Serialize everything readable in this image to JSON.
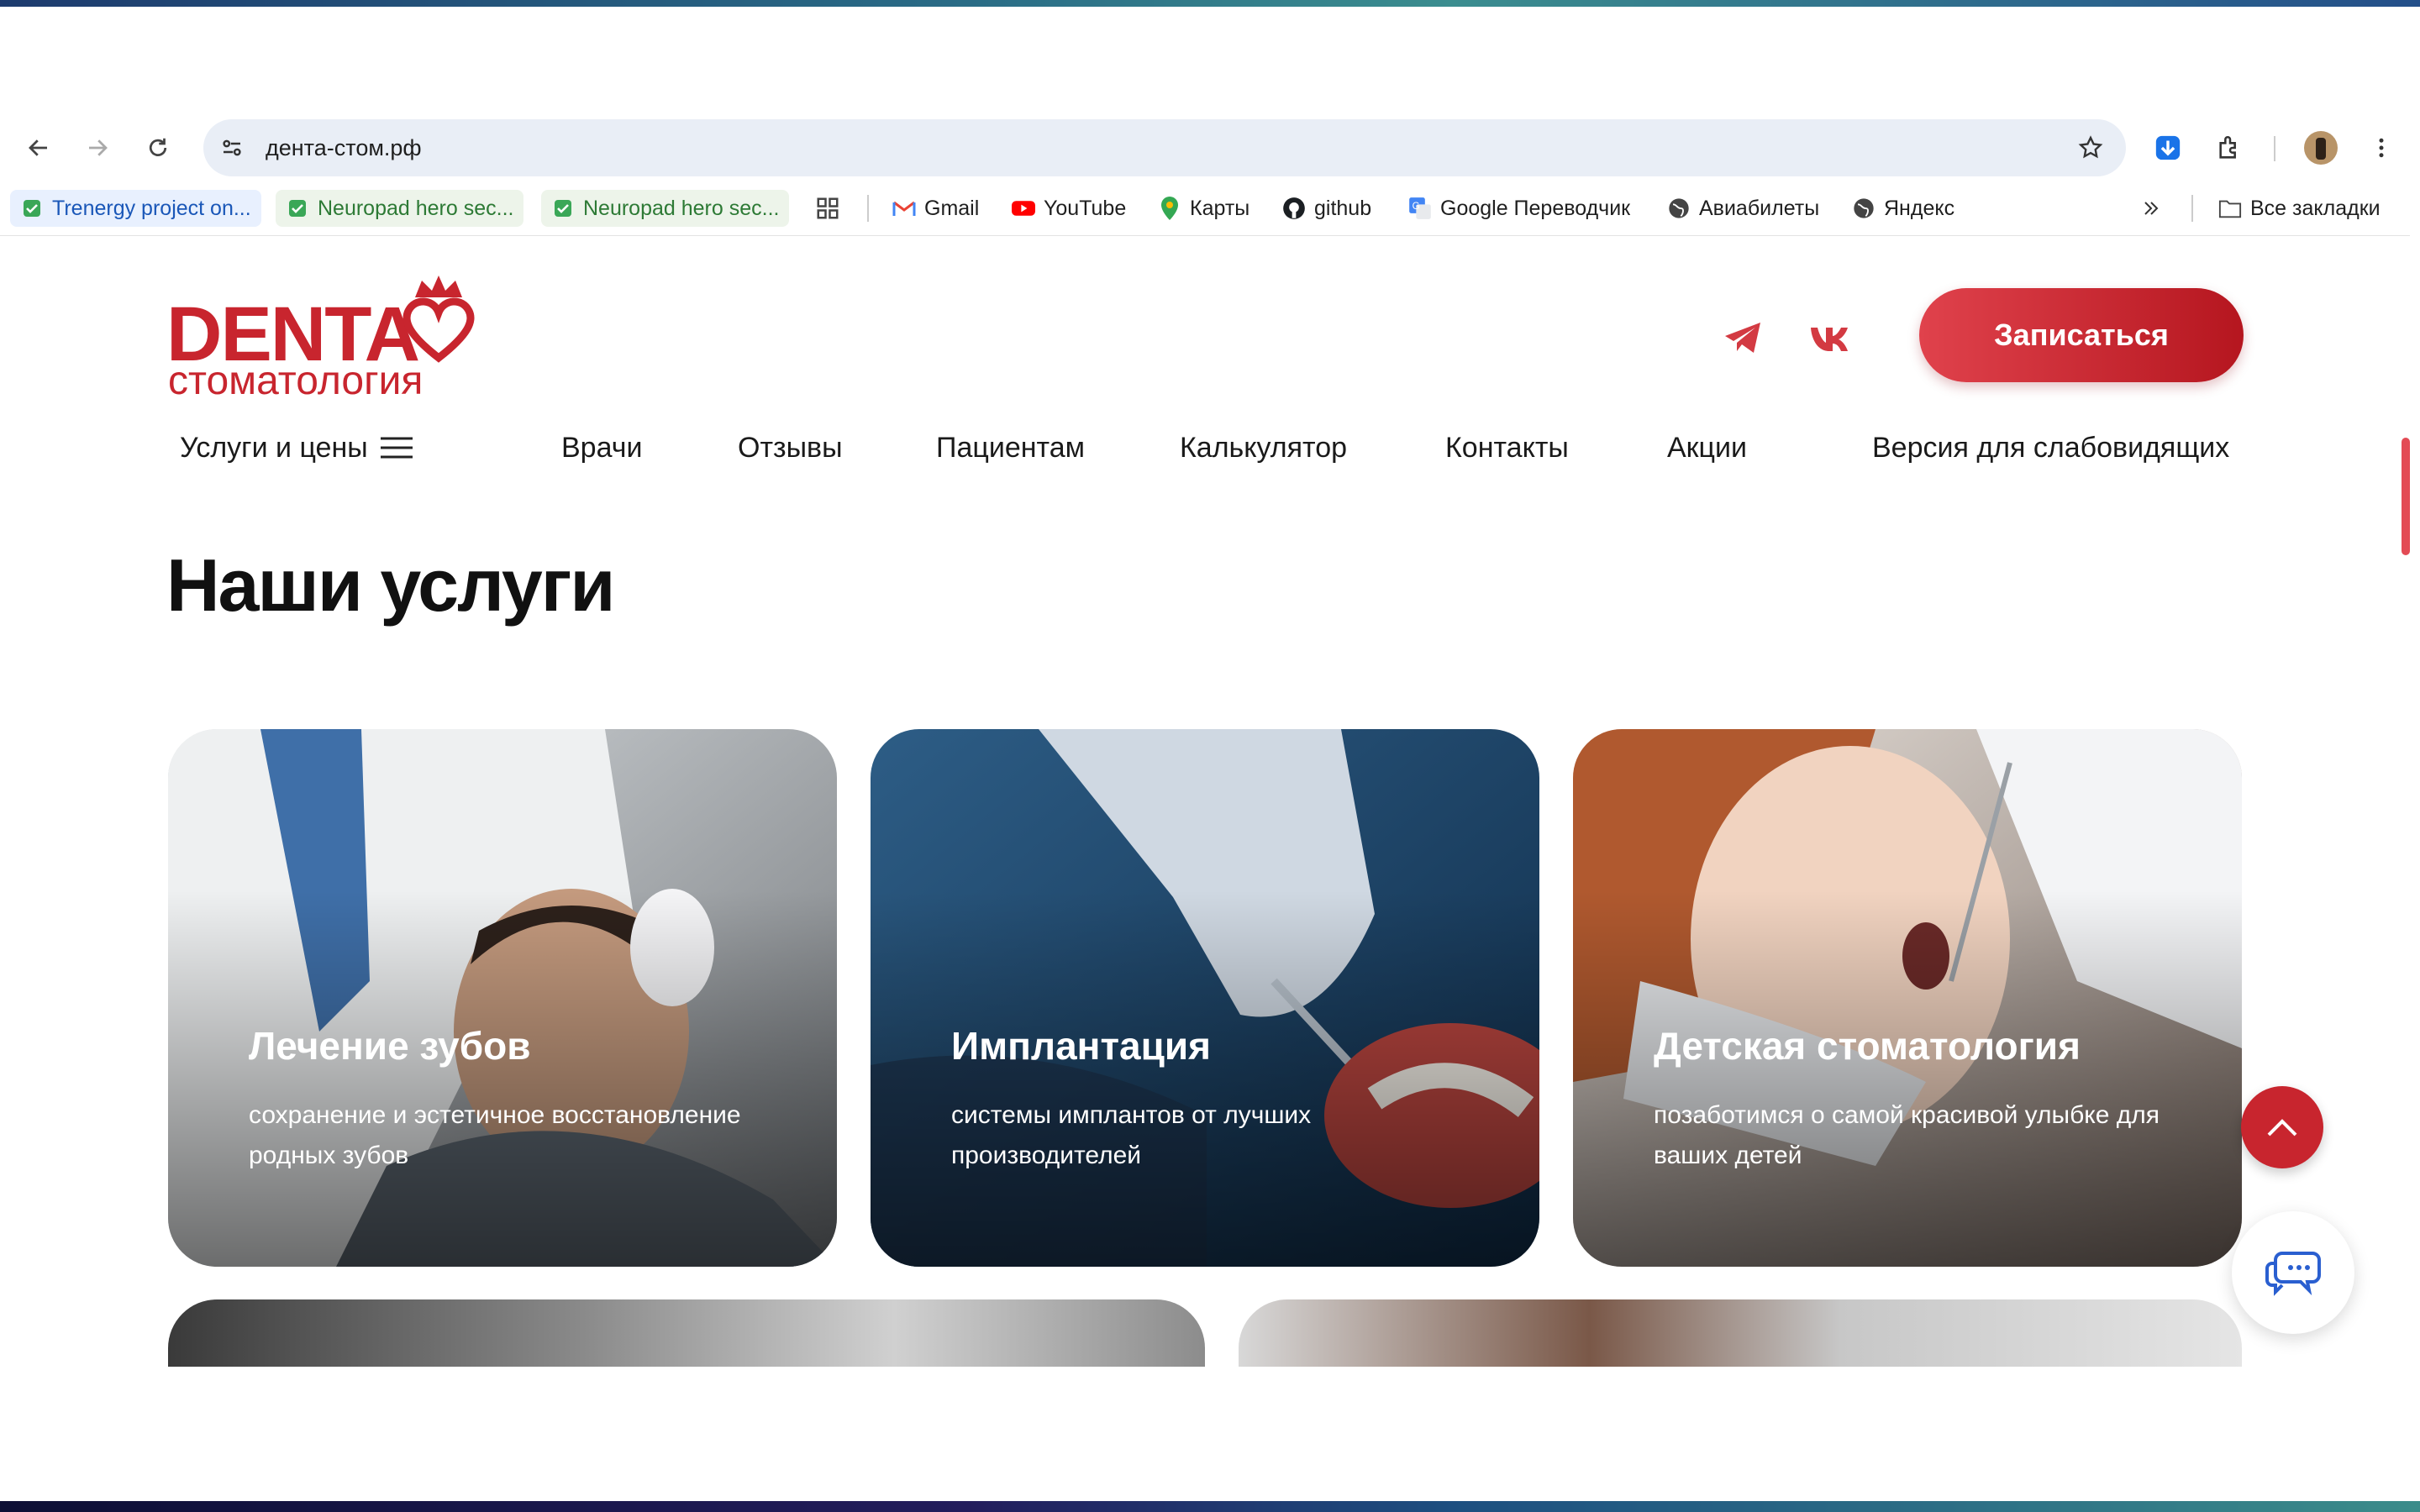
{
  "browser": {
    "url": "дента-стом.рф",
    "bookmarks": [
      {
        "label": "Trenergy project on...",
        "icon": "check-icon"
      },
      {
        "label": "Neuropad hero sec...",
        "icon": "check-icon"
      },
      {
        "label": "Neuropad hero sec...",
        "icon": "check-icon"
      },
      {
        "label": "Gmail",
        "icon": "gmail-icon"
      },
      {
        "label": "YouTube",
        "icon": "youtube-icon"
      },
      {
        "label": "Карты",
        "icon": "maps-icon"
      },
      {
        "label": "github",
        "icon": "github-icon"
      },
      {
        "label": "Google Переводчик",
        "icon": "translate-icon"
      },
      {
        "label": "Авиабилеты",
        "icon": "globe-icon"
      },
      {
        "label": "Яндекс",
        "icon": "globe-icon"
      }
    ],
    "all_bookmarks": "Все закладки"
  },
  "site": {
    "logo_brand": "DENTA",
    "logo_sub": "стоматология",
    "cta": "Записаться",
    "menu": {
      "services": "Услуги и цены",
      "doctors": "Врачи",
      "reviews": "Отзывы",
      "patients": "Пациентам",
      "calculator": "Калькулятор",
      "contacts": "Контакты",
      "promos": "Акции",
      "accessibility": "Версия для слабовидящих"
    },
    "section_title": "Наши услуги",
    "cards": [
      {
        "title": "Лечение зубов",
        "desc": "сохранение и эстетичное восстановление родных зубов"
      },
      {
        "title": "Имплантация",
        "desc": "системы имплантов от лучших производителей"
      },
      {
        "title": "Детская стоматология",
        "desc": "позаботимся о самой красивой улыбке для ваших детей"
      }
    ]
  },
  "colors": {
    "accent": "#c8252e",
    "omnibox": "#e9eef6"
  }
}
